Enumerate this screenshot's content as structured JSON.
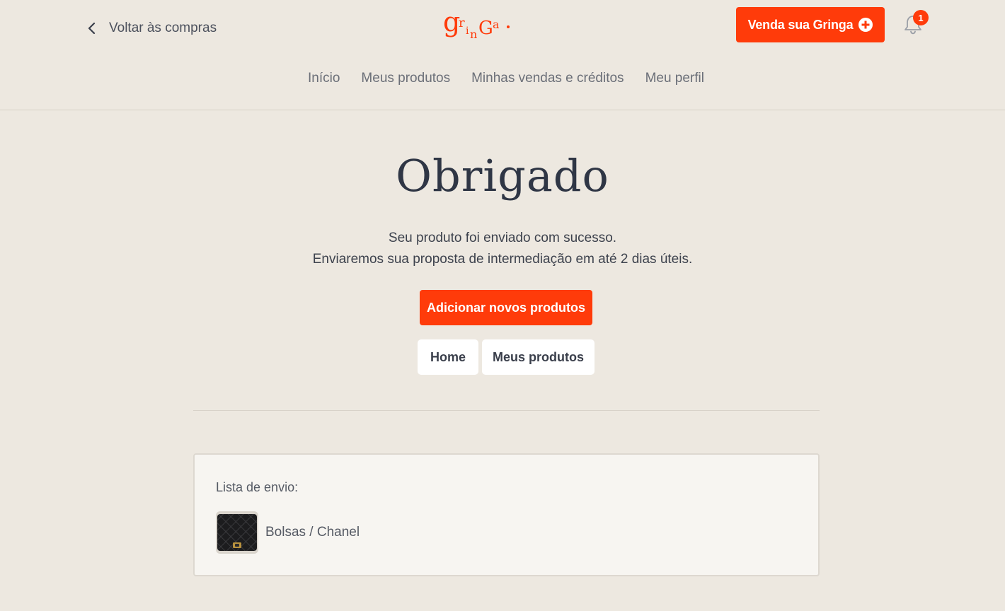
{
  "header": {
    "back_label": "Voltar às compras",
    "logo_text": "gringa.",
    "sell_label": "Venda sua Gringa",
    "notification_count": "1"
  },
  "nav": {
    "items": [
      "Início",
      "Meus produtos",
      "Minhas vendas e créditos",
      "Meu perfil"
    ]
  },
  "main": {
    "title": "Obrigado",
    "message_line1": "Seu produto foi enviado com sucesso.",
    "message_line2": "Enviaremos sua proposta de intermediação em até 2 dias úteis.",
    "add_button": "Adicionar novos produtos",
    "home_button": "Home",
    "my_products_button": "Meus produtos"
  },
  "shipping": {
    "title": "Lista de envio:",
    "items": [
      {
        "label": "Bolsas / Chanel",
        "thumbnail": "black-quilted-bag-image"
      }
    ]
  },
  "colors": {
    "accent": "#ff3b0a",
    "background": "#ede8e0",
    "card": "#f7f5f1"
  }
}
